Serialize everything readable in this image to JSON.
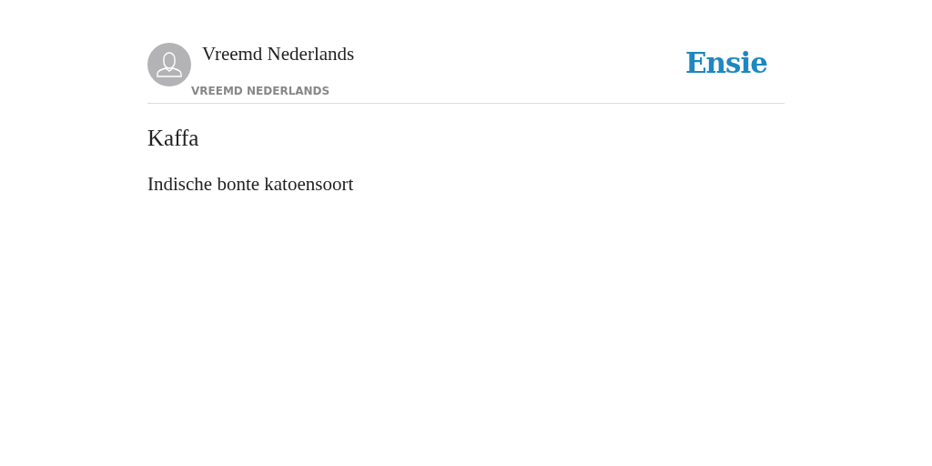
{
  "author": {
    "name": "Vreemd Nederlands",
    "category": "VREEMD NEDERLANDS"
  },
  "logo": "Ensie",
  "entry": {
    "title": "Kaffa",
    "definition": "Indische bonte katoensoort"
  }
}
